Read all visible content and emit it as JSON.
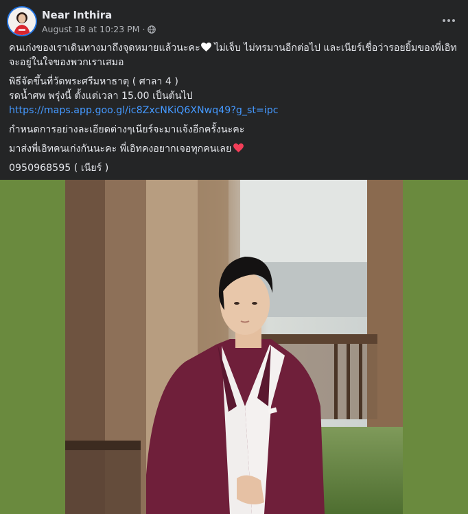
{
  "post": {
    "author": "Near Inthira",
    "timestamp": "August 18 at 10:23 PM",
    "separator": "·",
    "audience_icon": "globe-icon",
    "more_icon": "more-horizontal-icon",
    "lines": {
      "line1": "คนเก่งของเราเดินทางมาถึงจุดหมายแล้วนะคะ",
      "line1_after": " ไม่เจ็บ ไม่ทรมานอีกต่อไป และเนียร์เชื่อว่ารอยยิ้มของพี่เอิท",
      "line2": "จะอยู่ในใจของพวกเราเสมอ",
      "line3": "พิธีจัดขึ้นที่วัดพระศรีมหาธาตุ ( ศาลา 4 )",
      "line4": "รดน้ำศพ พรุ่งนี้ ตั้งแต่เวลา 15.00 เป็นต้นไป",
      "link": "https://maps.app.goo.gl/ic8ZxcNKiQ6XNwq49?g_st=ipc",
      "line5": "กำหนดการอย่างละเอียดต่างๆเนียร์จะมาแจ้งอีกครั้งนะคะ",
      "line6": "มาส่งพี่เอิทคนเก่งกันนะคะ พี่เอิทคงอยากเจอทุกคนเลย",
      "line7": "0950968595 ( เนียร์ )"
    }
  },
  "photo": {
    "background_color": "#6a8a3e",
    "subject": "man-in-burgundy-suit"
  },
  "colors": {
    "card_bg": "#242526",
    "primary_text": "#e4e6eb",
    "secondary_text": "#b0b3b8",
    "link": "#4599ff",
    "heart_red": "#f33e58"
  }
}
